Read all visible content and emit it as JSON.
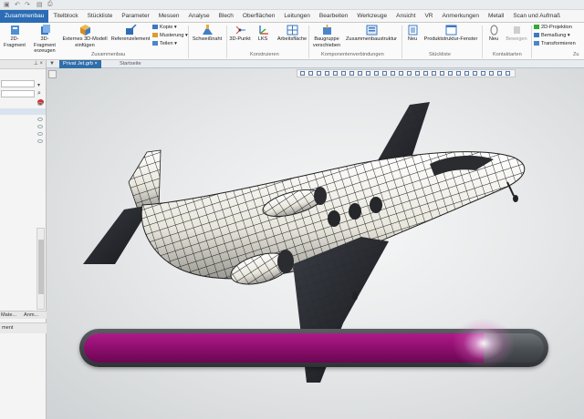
{
  "ribbon_tabs": [
    "Zusammenbau",
    "Titelblock",
    "Stückliste",
    "Parameter",
    "Messen",
    "Analyse",
    "Blech",
    "Oberflächen",
    "Leitungen",
    "Bearbeiten",
    "Werkzeuge",
    "Ansicht",
    "VR",
    "Anmerkungen",
    "Metall",
    "Scan und Aufmaß"
  ],
  "ribbon": {
    "fragment_btn": "2D-Fragment",
    "fragment3d_btn": "3D-Fragment erzeugen",
    "external_btn": "Externes 3D-Modell einfügen",
    "reference_btn": "Referenzelement",
    "copy_item": "Kopie",
    "pattern_item": "Musterung",
    "parts_item": "Teilen",
    "group_zusammenbau": "Zusammenbau",
    "weld_btn": "Schweißnaht",
    "point3d_btn": "3D-Punkt",
    "lks_btn": "LKS",
    "workplane_btn": "Arbeitsfläche",
    "group_konstruieren": "Konstruieren",
    "move_btn": "Baugruppe verschieben",
    "structure_btn": "Zusammenbaustruktur",
    "group_komponenten": "Komponentenverbindungen",
    "new_btn": "Neu",
    "product_btn": "Produktstruktur-Fenster",
    "group_stueckliste": "Stückliste",
    "new2_btn": "Neu",
    "move2_btn": "Bewegen",
    "group_kontakt": "Kontaktarten",
    "proj_item": "2D-Projektion",
    "dim_item": "Bemaßung",
    "transform_item": "Transformieren",
    "group_zu": "Zu"
  },
  "left_panel": {
    "tab1": "Mate...",
    "tab2": "Anm...",
    "footer": "ment"
  },
  "doc_tabs": {
    "active": "Privat Jet.grb",
    "inactive": "Startseite"
  },
  "progress": {
    "value": 0.87
  },
  "colors": {
    "accent": "#2b6cb5",
    "progress_fill": "#9c1379",
    "progress_track": "#4a4f53"
  }
}
